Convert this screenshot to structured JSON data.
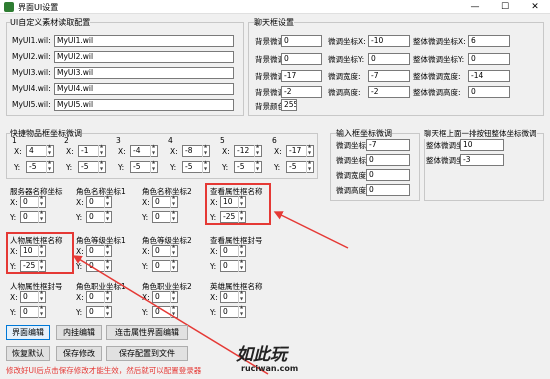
{
  "window": {
    "title": "界面UI设置",
    "min": "—",
    "max": "☐",
    "close": "✕"
  },
  "custom": {
    "title": "UI自定义素材读取配置",
    "rows": [
      {
        "label": "MyUI1.wil:",
        "value": "MyUI1.wil"
      },
      {
        "label": "MyUI2.wil:",
        "value": "MyUI2.wil"
      },
      {
        "label": "MyUI3.wil:",
        "value": "MyUI3.wil"
      },
      {
        "label": "MyUI4.wil:",
        "value": "MyUI4.wil"
      },
      {
        "label": "MyUI5.wil:",
        "value": "MyUI5.wil"
      }
    ]
  },
  "chat": {
    "title": "聊天框设置",
    "bg_x_label": "背景微调坐标X:",
    "bg_x": "0",
    "fine_x_label": "微调坐标X:",
    "fine_x": "-10",
    "whole_x_label": "整体微调坐标X:",
    "whole_x": "6",
    "bg_y_label": "背景微调坐标Y:",
    "bg_y": "0",
    "fine_y_label": "微调坐标Y:",
    "fine_y": "0",
    "whole_y_label": "整体微调坐标Y:",
    "whole_y": "0",
    "bg_w_label": "背景微调宽度:",
    "bg_w": "-17",
    "fine_w_label": "微调宽度:",
    "fine_w": "-7",
    "whole_w_label": "整体微调宽度:",
    "whole_w": "-14",
    "bg_h_label": "背景微调高度:",
    "bg_h": "-2",
    "fine_h_label": "微调高度:",
    "fine_h": "-2",
    "whole_h_label": "整体微调高度:",
    "whole_h": "0",
    "bg_color_label": "背景颜色:",
    "bg_color": "255"
  },
  "shortcut": {
    "title": "快捷物品框坐标微调",
    "slots": [
      {
        "n": "1",
        "x": "4",
        "y": "-5"
      },
      {
        "n": "2",
        "x": "-1",
        "y": "-5"
      },
      {
        "n": "3",
        "x": "-4",
        "y": "-5"
      },
      {
        "n": "4",
        "x": "-8",
        "y": "-5"
      },
      {
        "n": "5",
        "x": "-12",
        "y": "-5"
      },
      {
        "n": "6",
        "x": "-17",
        "y": "-5"
      }
    ]
  },
  "inputbox": {
    "title": "输入框坐标微调",
    "x_label": "微调坐标X:",
    "x": "-7",
    "y_label": "微调坐标Y:",
    "y": "0",
    "w_label": "微调宽度:",
    "w": "0",
    "h_label": "微调高度:",
    "h": "0"
  },
  "chatline": {
    "title": "聊天框上面一排按钮整体坐标微调",
    "x_label": "整体微调坐标X:",
    "x": "10",
    "y_label": "整体微调坐标Y:",
    "y": "-3"
  },
  "coords": [
    {
      "title": "服务器名称坐标",
      "x": "0",
      "y": "0"
    },
    {
      "title": "角色名称坐标1",
      "x": "0",
      "y": "0"
    },
    {
      "title": "角色名称坐标2",
      "x": "0",
      "y": "0"
    },
    {
      "title": "查看属性框名称",
      "x": "10",
      "y": "-25"
    },
    {
      "title": "人物属性框名称",
      "x": "10",
      "y": "-25"
    },
    {
      "title": "角色等级坐标1",
      "x": "0",
      "y": "0"
    },
    {
      "title": "角色等级坐标2",
      "x": "0",
      "y": "0"
    },
    {
      "title": "查看属性框封号",
      "x": "0",
      "y": "0"
    },
    {
      "title": "人物属性框封号",
      "x": "0",
      "y": "0"
    },
    {
      "title": "角色职业坐标1",
      "x": "0",
      "y": "0"
    },
    {
      "title": "角色职业坐标2",
      "x": "0",
      "y": "0"
    },
    {
      "title": "英雄属性框名称",
      "x": "0",
      "y": "0"
    }
  ],
  "axis": {
    "x": "X:",
    "y": "Y:"
  },
  "buttons": {
    "ui_edit": "界面编辑",
    "inner_edit": "内挂编辑",
    "connect_edit": "连击属性界面编辑",
    "restore": "恢复默认",
    "save": "保存修改",
    "save_file": "保存配置到文件"
  },
  "notice": "修改好UI后点击保存修改才能生效，然后就可以配置登录器",
  "watermark": {
    "main": "如此玩",
    "sub": "ruciwan.com"
  },
  "colors": {
    "highlight": "#e53935",
    "accent": "#0078d7"
  }
}
